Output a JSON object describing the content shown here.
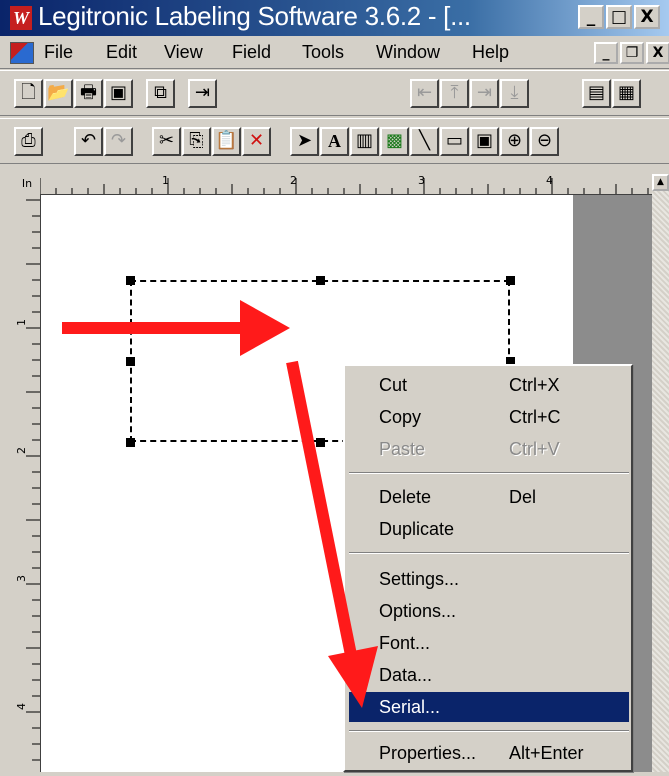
{
  "window": {
    "title": "Legitronic Labeling Software 3.6.2 - [...",
    "app_icon_glyph": "W",
    "controls": {
      "minimize": "_",
      "maximize": "□",
      "close": "X"
    }
  },
  "menubar": {
    "items": [
      "File",
      "Edit",
      "View",
      "Field",
      "Tools",
      "Window",
      "Help"
    ],
    "mdi_controls": {
      "minimize": "_",
      "restore": "❐",
      "close": "X"
    }
  },
  "toolbar1": {
    "buttons": [
      {
        "name": "new-file-icon",
        "glyph": "🗋"
      },
      {
        "name": "open-folder-icon",
        "glyph": "📂"
      },
      {
        "name": "print-preview-icon",
        "glyph": "🖶"
      },
      {
        "name": "save-disk-icon",
        "glyph": "▣"
      },
      {
        "name": "picture-icon",
        "glyph": "⧉"
      },
      {
        "name": "exit-door-icon",
        "glyph": "⇥"
      },
      {
        "name": "align-left-icon",
        "glyph": "⇤"
      },
      {
        "name": "align-top-icon",
        "glyph": "⤒"
      },
      {
        "name": "align-right-icon",
        "glyph": "⇥"
      },
      {
        "name": "align-bottom-icon",
        "glyph": "⤓"
      },
      {
        "name": "group-icon",
        "glyph": "▤"
      },
      {
        "name": "ungroup-icon",
        "glyph": "▦"
      }
    ]
  },
  "toolbar2": {
    "buttons": [
      {
        "name": "printer-icon",
        "glyph": "⎙"
      },
      {
        "name": "undo-icon",
        "glyph": "↶"
      },
      {
        "name": "redo-icon",
        "glyph": "↷"
      },
      {
        "name": "cut-scissors-icon",
        "glyph": "✂"
      },
      {
        "name": "copy-icon",
        "glyph": "⎘"
      },
      {
        "name": "paste-clipboard-icon",
        "glyph": "📋"
      },
      {
        "name": "delete-x-icon",
        "glyph": "✕"
      },
      {
        "name": "pointer-arrow-icon",
        "glyph": "➤"
      },
      {
        "name": "text-tool-icon",
        "glyph": "A"
      },
      {
        "name": "barcode-tool-icon",
        "glyph": "▥"
      },
      {
        "name": "image-tool-icon",
        "glyph": "▩"
      },
      {
        "name": "line-tool-icon",
        "glyph": "╲"
      },
      {
        "name": "rectangle-tool-icon",
        "glyph": "▭"
      },
      {
        "name": "field-box-icon",
        "glyph": "▣"
      },
      {
        "name": "zoom-in-icon",
        "glyph": "⊕"
      },
      {
        "name": "zoom-out-icon",
        "glyph": "⊖"
      }
    ]
  },
  "ruler": {
    "unit": "In",
    "h_labels": [
      "1",
      "2",
      "3",
      "4"
    ],
    "v_labels": [
      "1",
      "2",
      "3",
      "4"
    ]
  },
  "context_menu": {
    "items": [
      {
        "label": "Cut",
        "shortcut": "Ctrl+X",
        "disabled": false
      },
      {
        "label": "Copy",
        "shortcut": "Ctrl+C",
        "disabled": false
      },
      {
        "label": "Paste",
        "shortcut": "Ctrl+V",
        "disabled": true
      },
      {
        "label": "Delete",
        "shortcut": "Del",
        "disabled": false
      },
      {
        "label": "Duplicate",
        "shortcut": "",
        "disabled": false
      },
      {
        "label": "Settings...",
        "shortcut": "",
        "disabled": false
      },
      {
        "label": "Options...",
        "shortcut": "",
        "disabled": false
      },
      {
        "label": "Font...",
        "shortcut": "",
        "disabled": false
      },
      {
        "label": "Data...",
        "shortcut": "",
        "disabled": false
      },
      {
        "label": "Serial...",
        "shortcut": "",
        "disabled": false,
        "highlighted": true
      },
      {
        "label": "Properties...",
        "shortcut": "Alt+Enter",
        "disabled": false
      }
    ]
  },
  "annotation_color": "#ff1a1a",
  "highlight_color": "#0a246a"
}
